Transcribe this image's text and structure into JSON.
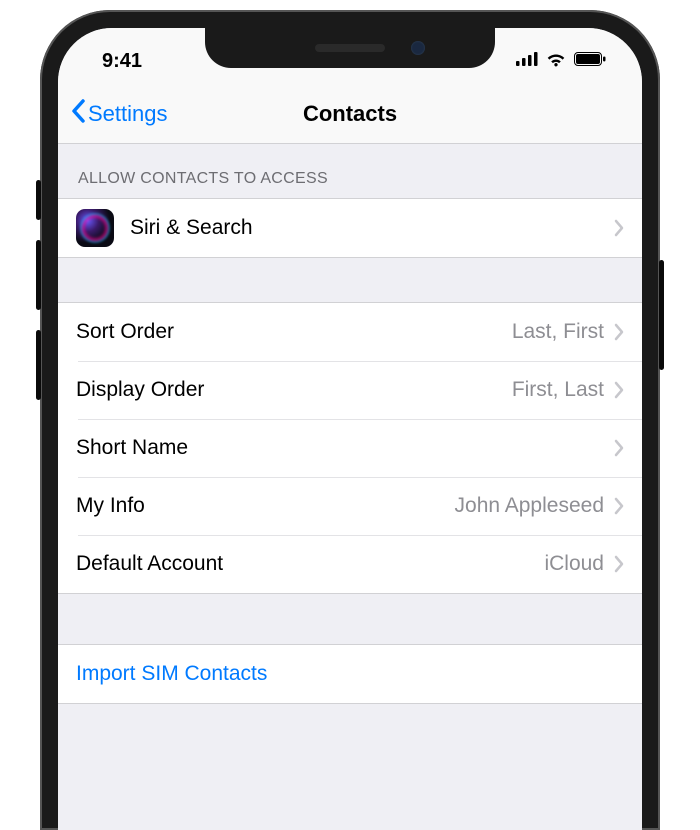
{
  "status": {
    "time": "9:41"
  },
  "nav": {
    "back_label": "Settings",
    "title": "Contacts"
  },
  "sections": {
    "access": {
      "header": "Allow Contacts to Access",
      "siri_label": "Siri & Search"
    },
    "settings": {
      "sort_order": {
        "label": "Sort Order",
        "value": "Last, First"
      },
      "display_order": {
        "label": "Display Order",
        "value": "First, Last"
      },
      "short_name": {
        "label": "Short Name",
        "value": ""
      },
      "my_info": {
        "label": "My Info",
        "value": "John Appleseed"
      },
      "default_account": {
        "label": "Default Account",
        "value": "iCloud"
      }
    },
    "import": {
      "label": "Import SIM Contacts"
    }
  }
}
